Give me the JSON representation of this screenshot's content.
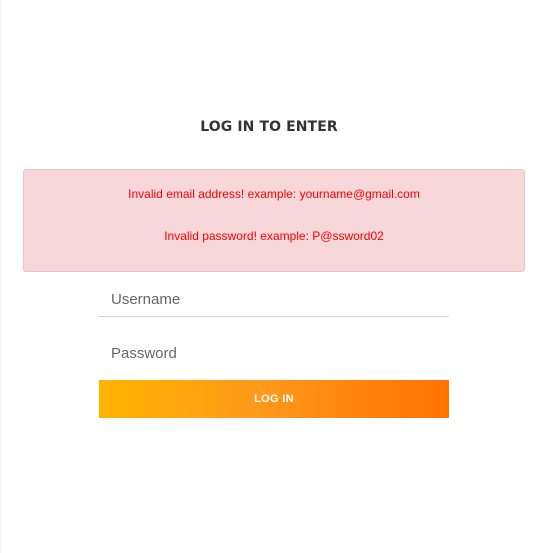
{
  "login": {
    "title": "LOG IN TO ENTER",
    "errors": {
      "email": "Invalid email address! example: yourname@gmail.com",
      "password": "Invalid password! example: P@ssword02"
    },
    "fields": {
      "username_placeholder": "Username",
      "username_value": "",
      "password_placeholder": "Password",
      "password_value": ""
    },
    "button_label": "LOG IN"
  },
  "colors": {
    "error_background": "#f8d7da",
    "error_text": "#ff0000",
    "button_gradient_start": "#ffb300",
    "button_gradient_end": "#ff7200"
  }
}
